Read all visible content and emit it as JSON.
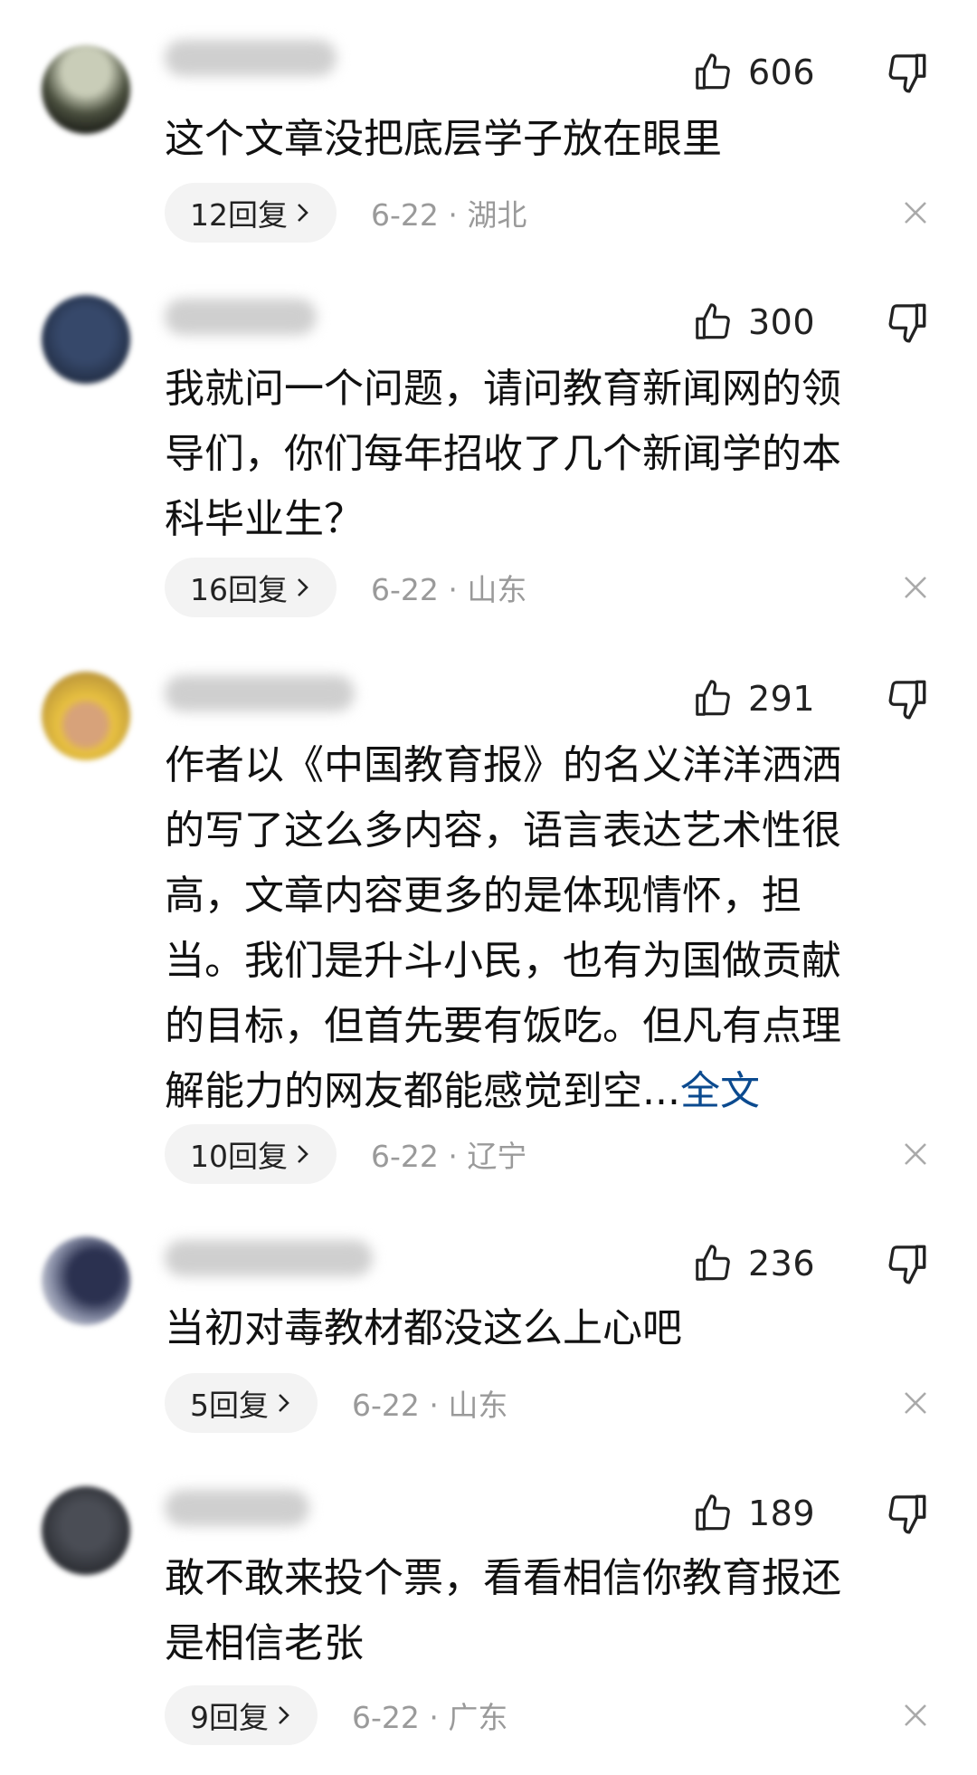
{
  "comments": [
    {
      "likes": "606",
      "text_lines": [
        "这个文章没把底层学子放在眼里"
      ],
      "replies": "12回复",
      "meta": "6-22 · 湖北",
      "avatar_color": "#6b6f5c"
    },
    {
      "likes": "300",
      "text_lines": [
        "我就问一个问题，请问教育新闻网的领",
        "导们，你们每年招收了几个新闻学的本",
        "科毕业生？"
      ],
      "replies": "16回复",
      "meta": "6-22 · 山东",
      "avatar_color": "#2c3b52"
    },
    {
      "likes": "291",
      "text_lines": [
        "作者以《中国教育报》的名义洋洋洒洒",
        "的写了这么多内容，语言表达艺术性很",
        "高，文章内容更多的是体现情怀，担",
        "当。我们是升斗小民，也有为国做贡献",
        "的目标，但首先要有饭吃。但凡有点理",
        "解能力的网友都能感觉到空..."
      ],
      "full_text_link": "全文",
      "replies": "10回复",
      "meta": "6-22 · 辽宁",
      "avatar_color": "#d9b14a"
    },
    {
      "likes": "236",
      "text_lines": [
        "当初对毒教材都没这么上心吧"
      ],
      "replies": "5回复",
      "meta": "6-22 · 山东",
      "avatar_color": "#3a3f58"
    },
    {
      "likes": "189",
      "text_lines": [
        "敢不敢来投个票，看看相信你教育报还",
        "是相信老张"
      ],
      "replies": "9回复",
      "meta": "6-22 · 广东",
      "avatar_color": "#3a3d44"
    }
  ],
  "colors": {
    "link": "#0b4a8f",
    "meta_gray": "#9a9a9a",
    "pill_bg": "#f3f3f3"
  },
  "icons": [
    "thumbs-up-icon",
    "thumbs-down-icon",
    "chevron-right-icon",
    "close-icon"
  ]
}
